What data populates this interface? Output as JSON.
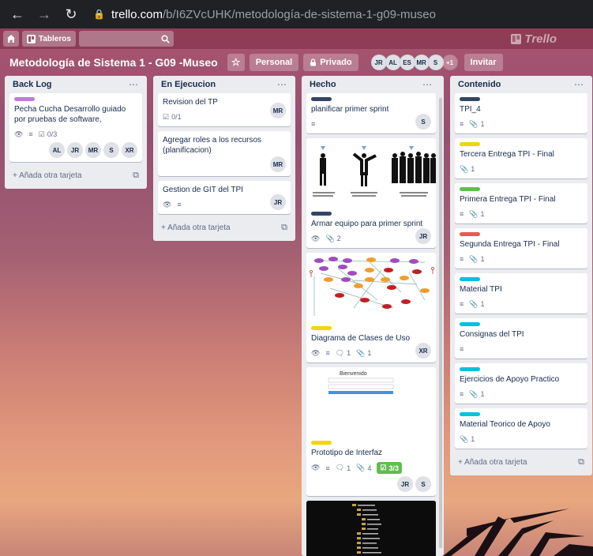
{
  "browser": {
    "url_host": "trello.com",
    "url_path": "/b/I6ZVcUHK/metodología-de-sistema-1-g09-museo"
  },
  "header": {
    "boards_label": "Tableros",
    "logo_text": "Trello"
  },
  "board": {
    "title": "Metodología de Sistema 1 - G09 -Museo",
    "personal_label": "Personal",
    "privacy_label": "Privado",
    "members": [
      "JR",
      "AL",
      "ES",
      "MR",
      "S"
    ],
    "more_members": "+1",
    "invite_label": "Invitar"
  },
  "colors": {
    "purple": "#c377e0",
    "navy": "#344563",
    "yellow": "#f2d600",
    "green": "#61bd4f",
    "red": "#eb5a46",
    "sky": "#00c2e0"
  },
  "lists": [
    {
      "title": "Back Log",
      "add_label": "+ Añada otra tarjeta",
      "cards": [
        {
          "title": "Pecha Cucha Desarrollo guiado por pruebas de software,",
          "checklist": "0/3",
          "members": [
            "AL",
            "JR",
            "MR",
            "S",
            "XR"
          ]
        }
      ]
    },
    {
      "title": "En Ejecucion",
      "add_label": "+ Añada otra tarjeta",
      "cards": [
        {
          "title": "Revision del TP",
          "checklist": "0/1",
          "member": "MR"
        },
        {
          "title": "Agregar roles a los recursos (planificacion)",
          "member": "MR"
        },
        {
          "title": "Gestion de GIT del TPI",
          "member": "JR"
        }
      ]
    },
    {
      "title": "Hecho",
      "cards": [
        {
          "title": "planificar primer sprint",
          "member": "S"
        },
        {
          "title": "Armar equipo para primer sprint",
          "attachments": "2",
          "member": "JR"
        },
        {
          "title": "Diagrama de Clases de Uso",
          "comments": "1",
          "attachments": "1",
          "member": "XR"
        },
        {
          "title": "Prototipo de Interfaz",
          "comments": "1",
          "attachments": "4",
          "checklist": "3/3",
          "members": [
            "JR",
            "S"
          ]
        }
      ]
    },
    {
      "title": "Contenido",
      "add_label": "+ Añada otra tarjeta",
      "cards": [
        {
          "title": "TPI_4",
          "attachments": "1"
        },
        {
          "title": "Tercera Entrega TPI - Final",
          "attachments": "1"
        },
        {
          "title": "Primera Entrega TPI - Final",
          "attachments": "1"
        },
        {
          "title": "Segunda Entrega TPI - Final",
          "attachments": "1"
        },
        {
          "title": "Material TPI",
          "attachments": "1"
        },
        {
          "title": "Consignas del TPI"
        },
        {
          "title": "Ejercicios de Apoyo Practico",
          "attachments": "1"
        },
        {
          "title": "Material Teorico de Apoyo",
          "attachments": "1"
        }
      ]
    }
  ],
  "prototype_cover": {
    "welcome": "Bienvenido"
  }
}
